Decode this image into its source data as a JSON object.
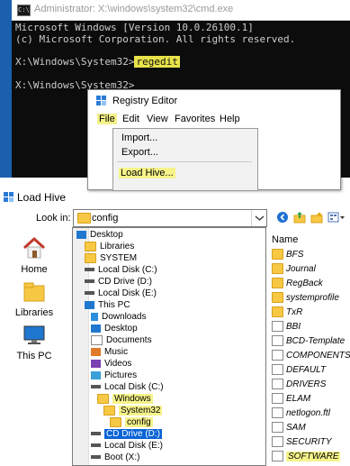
{
  "cmd": {
    "title": "Administrator: X:\\windows\\system32\\cmd.exe",
    "icon": "cmd-icon",
    "line1": "Microsoft Windows [Version 10.0.26100.1]",
    "line2": "(c) Microsoft Corporation. All rights reserved.",
    "prompt1": "X:\\Windows\\System32>",
    "command1": "regedit",
    "prompt2": "X:\\Windows\\System32>"
  },
  "regedit": {
    "title": "Registry Editor",
    "menu": [
      "File",
      "Edit",
      "View",
      "Favorites",
      "Help"
    ],
    "dropdown": [
      "Import...",
      "Export...",
      "Load Hive..."
    ]
  },
  "dialog": {
    "title": "Load Hive",
    "lookin_label": "Look in:",
    "lookin_value": "config",
    "places": [
      "Home",
      "Libraries",
      "This PC"
    ],
    "tree": [
      "Desktop",
      "Libraries",
      "SYSTEM",
      "Local Disk (C:)",
      "CD Drive (D:)",
      "Local Disk (E:)",
      "This PC",
      "Downloads",
      "Desktop",
      "Documents",
      "Music",
      "Videos",
      "Pictures",
      "Local Disk (C:)",
      "Windows",
      "System32",
      "config",
      "CD Drive (D:)",
      "Local Disk (E:)",
      "Boot (X:)"
    ],
    "column_header": "Name",
    "files": [
      "BFS",
      "Journal",
      "RegBack",
      "systemprofile",
      "TxR",
      "BBI",
      "BCD-Template",
      "COMPONENTS",
      "DEFAULT",
      "DRIVERS",
      "ELAM",
      "netlogon.ftl",
      "SAM",
      "SECURITY",
      "SOFTWARE"
    ]
  },
  "colors": {
    "highlight": "#f4ef4a",
    "selection": "#0a64d6",
    "folder": "#f7c843"
  }
}
